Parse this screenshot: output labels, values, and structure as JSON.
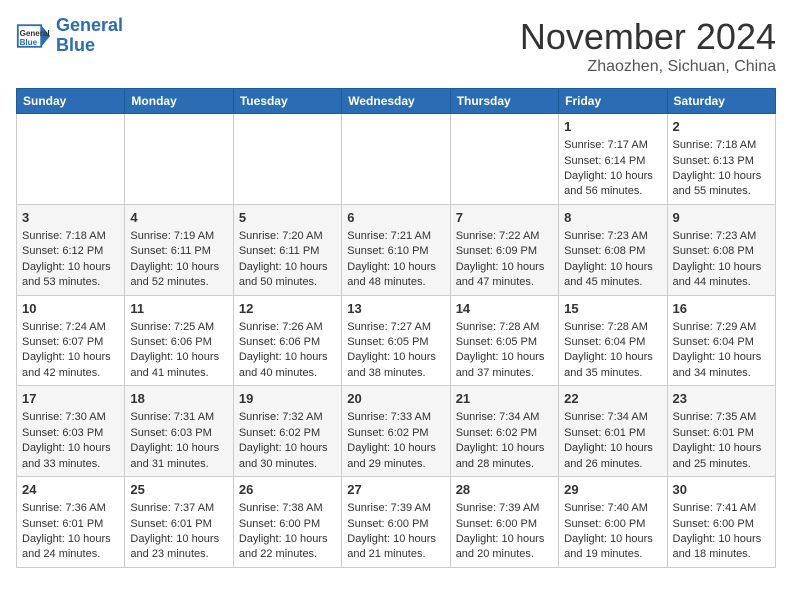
{
  "header": {
    "logo_line1": "General",
    "logo_line2": "Blue",
    "month": "November 2024",
    "location": "Zhaozhen, Sichuan, China"
  },
  "days_of_week": [
    "Sunday",
    "Monday",
    "Tuesday",
    "Wednesday",
    "Thursday",
    "Friday",
    "Saturday"
  ],
  "weeks": [
    [
      {
        "day": "",
        "content": ""
      },
      {
        "day": "",
        "content": ""
      },
      {
        "day": "",
        "content": ""
      },
      {
        "day": "",
        "content": ""
      },
      {
        "day": "",
        "content": ""
      },
      {
        "day": "1",
        "content": "Sunrise: 7:17 AM\nSunset: 6:14 PM\nDaylight: 10 hours and 56 minutes."
      },
      {
        "day": "2",
        "content": "Sunrise: 7:18 AM\nSunset: 6:13 PM\nDaylight: 10 hours and 55 minutes."
      }
    ],
    [
      {
        "day": "3",
        "content": "Sunrise: 7:18 AM\nSunset: 6:12 PM\nDaylight: 10 hours and 53 minutes."
      },
      {
        "day": "4",
        "content": "Sunrise: 7:19 AM\nSunset: 6:11 PM\nDaylight: 10 hours and 52 minutes."
      },
      {
        "day": "5",
        "content": "Sunrise: 7:20 AM\nSunset: 6:11 PM\nDaylight: 10 hours and 50 minutes."
      },
      {
        "day": "6",
        "content": "Sunrise: 7:21 AM\nSunset: 6:10 PM\nDaylight: 10 hours and 48 minutes."
      },
      {
        "day": "7",
        "content": "Sunrise: 7:22 AM\nSunset: 6:09 PM\nDaylight: 10 hours and 47 minutes."
      },
      {
        "day": "8",
        "content": "Sunrise: 7:23 AM\nSunset: 6:08 PM\nDaylight: 10 hours and 45 minutes."
      },
      {
        "day": "9",
        "content": "Sunrise: 7:23 AM\nSunset: 6:08 PM\nDaylight: 10 hours and 44 minutes."
      }
    ],
    [
      {
        "day": "10",
        "content": "Sunrise: 7:24 AM\nSunset: 6:07 PM\nDaylight: 10 hours and 42 minutes."
      },
      {
        "day": "11",
        "content": "Sunrise: 7:25 AM\nSunset: 6:06 PM\nDaylight: 10 hours and 41 minutes."
      },
      {
        "day": "12",
        "content": "Sunrise: 7:26 AM\nSunset: 6:06 PM\nDaylight: 10 hours and 40 minutes."
      },
      {
        "day": "13",
        "content": "Sunrise: 7:27 AM\nSunset: 6:05 PM\nDaylight: 10 hours and 38 minutes."
      },
      {
        "day": "14",
        "content": "Sunrise: 7:28 AM\nSunset: 6:05 PM\nDaylight: 10 hours and 37 minutes."
      },
      {
        "day": "15",
        "content": "Sunrise: 7:28 AM\nSunset: 6:04 PM\nDaylight: 10 hours and 35 minutes."
      },
      {
        "day": "16",
        "content": "Sunrise: 7:29 AM\nSunset: 6:04 PM\nDaylight: 10 hours and 34 minutes."
      }
    ],
    [
      {
        "day": "17",
        "content": "Sunrise: 7:30 AM\nSunset: 6:03 PM\nDaylight: 10 hours and 33 minutes."
      },
      {
        "day": "18",
        "content": "Sunrise: 7:31 AM\nSunset: 6:03 PM\nDaylight: 10 hours and 31 minutes."
      },
      {
        "day": "19",
        "content": "Sunrise: 7:32 AM\nSunset: 6:02 PM\nDaylight: 10 hours and 30 minutes."
      },
      {
        "day": "20",
        "content": "Sunrise: 7:33 AM\nSunset: 6:02 PM\nDaylight: 10 hours and 29 minutes."
      },
      {
        "day": "21",
        "content": "Sunrise: 7:34 AM\nSunset: 6:02 PM\nDaylight: 10 hours and 28 minutes."
      },
      {
        "day": "22",
        "content": "Sunrise: 7:34 AM\nSunset: 6:01 PM\nDaylight: 10 hours and 26 minutes."
      },
      {
        "day": "23",
        "content": "Sunrise: 7:35 AM\nSunset: 6:01 PM\nDaylight: 10 hours and 25 minutes."
      }
    ],
    [
      {
        "day": "24",
        "content": "Sunrise: 7:36 AM\nSunset: 6:01 PM\nDaylight: 10 hours and 24 minutes."
      },
      {
        "day": "25",
        "content": "Sunrise: 7:37 AM\nSunset: 6:01 PM\nDaylight: 10 hours and 23 minutes."
      },
      {
        "day": "26",
        "content": "Sunrise: 7:38 AM\nSunset: 6:00 PM\nDaylight: 10 hours and 22 minutes."
      },
      {
        "day": "27",
        "content": "Sunrise: 7:39 AM\nSunset: 6:00 PM\nDaylight: 10 hours and 21 minutes."
      },
      {
        "day": "28",
        "content": "Sunrise: 7:39 AM\nSunset: 6:00 PM\nDaylight: 10 hours and 20 minutes."
      },
      {
        "day": "29",
        "content": "Sunrise: 7:40 AM\nSunset: 6:00 PM\nDaylight: 10 hours and 19 minutes."
      },
      {
        "day": "30",
        "content": "Sunrise: 7:41 AM\nSunset: 6:00 PM\nDaylight: 10 hours and 18 minutes."
      }
    ]
  ]
}
